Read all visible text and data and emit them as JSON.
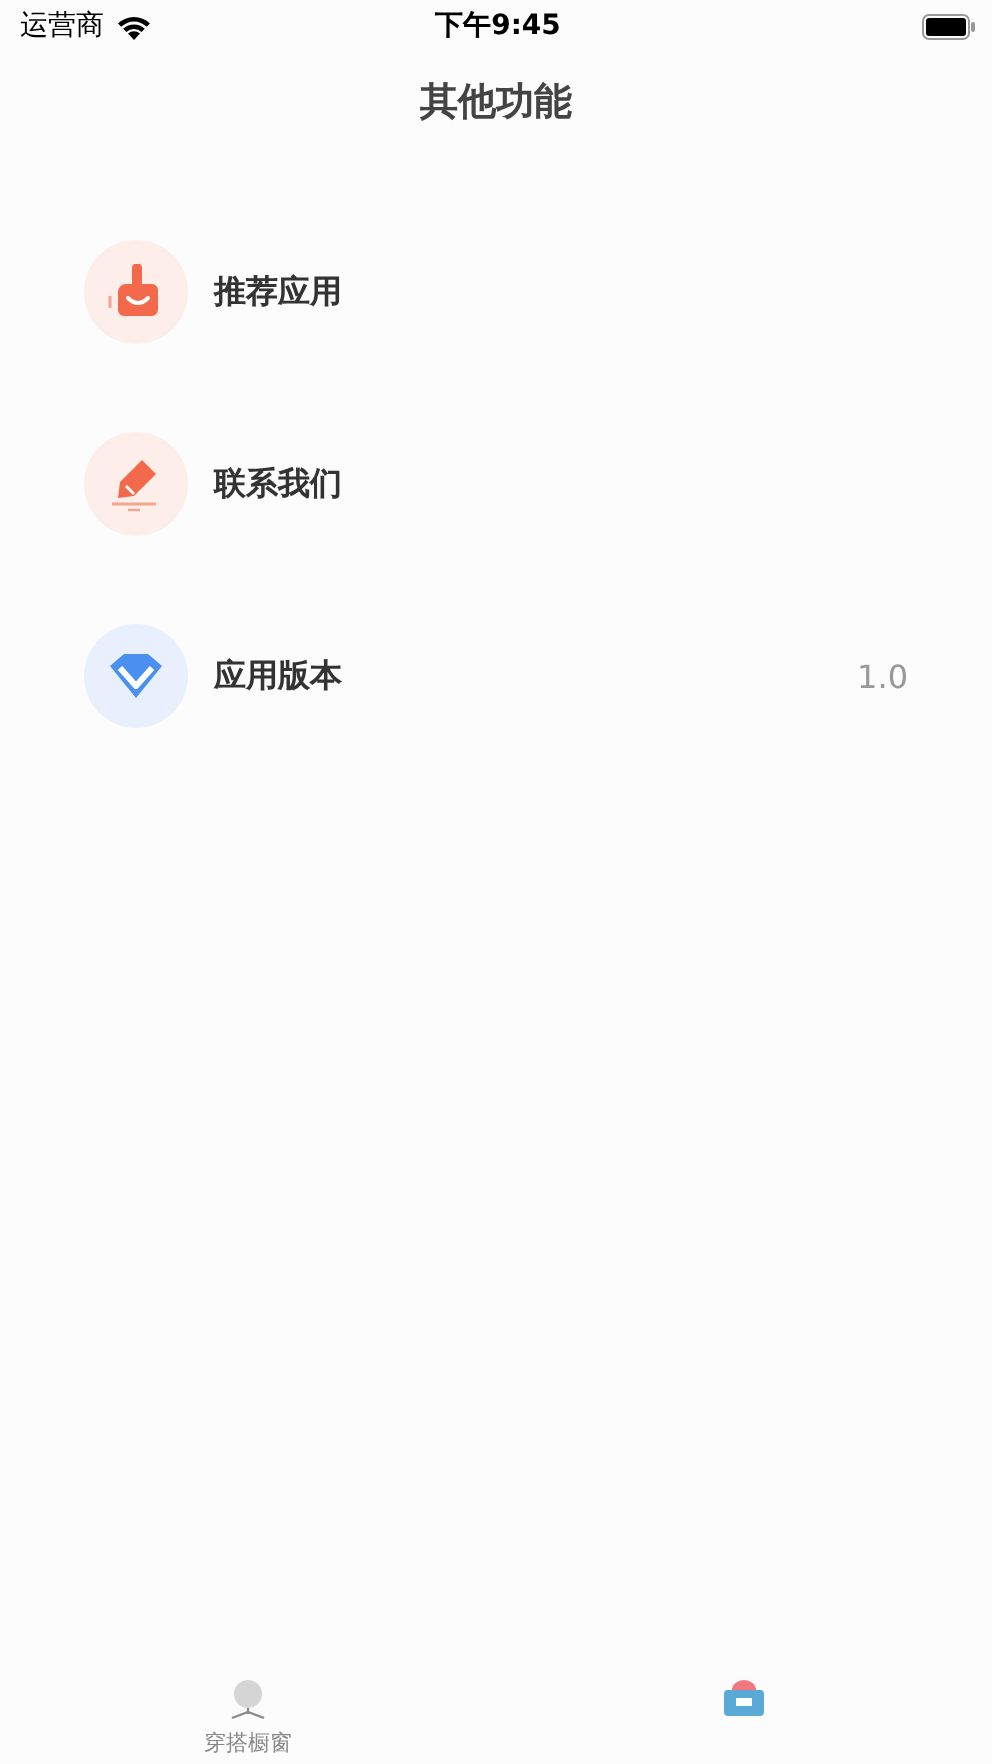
{
  "status_bar": {
    "carrier": "运营商",
    "time": "下午9:45"
  },
  "title": "其他功能",
  "items": [
    {
      "kind": "thumb",
      "label": "推荐应用"
    },
    {
      "kind": "pen",
      "label": "联系我们"
    },
    {
      "kind": "diamond",
      "label": "应用版本",
      "value": "1.0"
    }
  ],
  "tab_bar": [
    {
      "kind": "hanger",
      "label": "穿搭橱窗",
      "selected": false
    },
    {
      "kind": "box",
      "selected": true
    }
  ]
}
